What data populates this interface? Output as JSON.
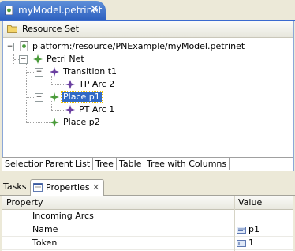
{
  "editor": {
    "tab_title": "myModel.petrinet",
    "close_glyph": "✕"
  },
  "resource_set": {
    "label": "Resource Set"
  },
  "tree": {
    "root": "platform:/resource/PNExample/myModel.petrinet",
    "petri_net": "Petri Net",
    "transition": "Transition t1",
    "tp_arc": "TP Arc 2",
    "place_p1": "Place p1",
    "pt_arc": "PT Arc 1",
    "place_p2": "Place p2",
    "collapse_glyph": "−"
  },
  "sub_tabs": [
    "Selection",
    "Parent",
    "List",
    "Tree",
    "Table",
    "Tree with Columns"
  ],
  "views": {
    "tasks": "Tasks",
    "properties": "Properties",
    "close_glyph": "✕"
  },
  "properties": {
    "col_property": "Property",
    "col_value": "Value",
    "rows": [
      {
        "name": "Incoming Arcs",
        "value": ""
      },
      {
        "name": "Name",
        "value": "p1"
      },
      {
        "name": "Token",
        "value": "1"
      }
    ]
  },
  "colors": {
    "accent": "#316ac5",
    "node_green": "#4a9b3a",
    "node_purple": "#6a3fa0"
  },
  "icons": [
    "file-icon",
    "resource-set-icon",
    "petrinet-icon",
    "transition-icon",
    "place-icon",
    "arc-icon",
    "properties-icon"
  ]
}
